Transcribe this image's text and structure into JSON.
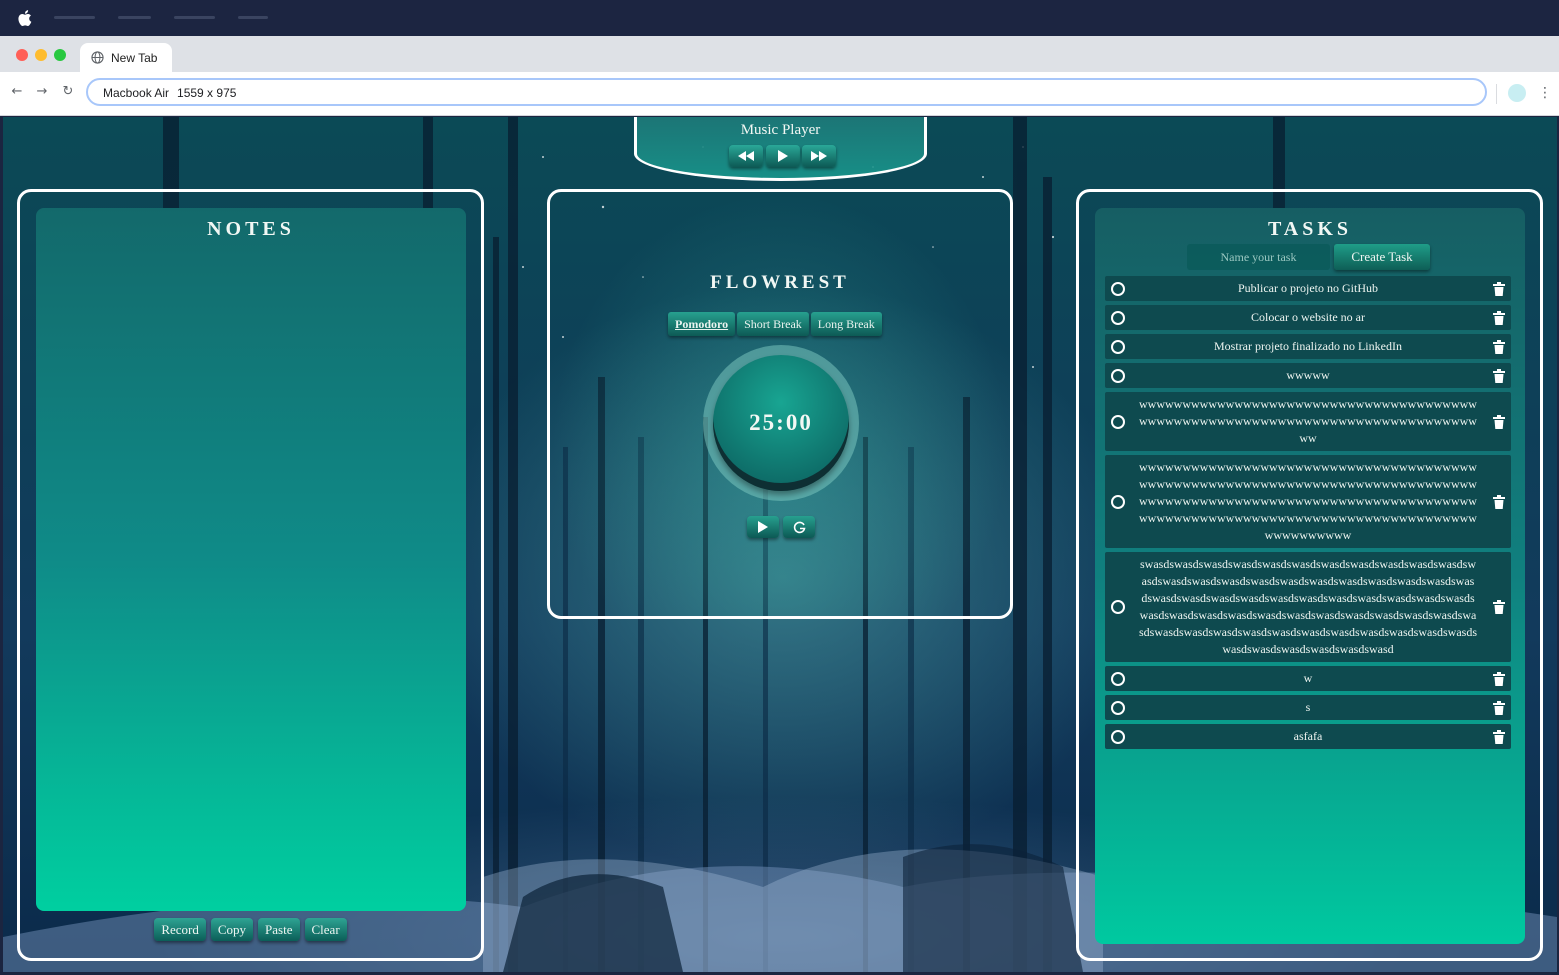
{
  "browser": {
    "tab_title": "New Tab",
    "address": "Macbook Air",
    "address_dims": "1559 x 975"
  },
  "music_player": {
    "title": "Music Player",
    "controls": [
      "rewind-icon",
      "play-icon",
      "fast-forward-icon"
    ]
  },
  "notes": {
    "title": "NOTES",
    "buttons": [
      "Record",
      "Copy",
      "Paste",
      "Clear"
    ]
  },
  "timer": {
    "title": "FLOWREST",
    "modes": [
      "Pomodoro",
      "Short Break",
      "Long Break"
    ],
    "active_mode": "Pomodoro",
    "time": "25:00",
    "controls": [
      "play-icon",
      "reset-icon"
    ]
  },
  "tasks": {
    "title": "TASKS",
    "input_placeholder": "Name your task",
    "create_label": "Create Task",
    "items": [
      {
        "text": "Publicar o projeto no GitHub"
      },
      {
        "text": "Colocar o website no ar"
      },
      {
        "text": "Mostrar projeto finalizado no LinkedIn"
      },
      {
        "text": "wwwww"
      },
      {
        "text": "wwwwwwwwwwwwwwwwwwwwwwwwwwwwwwwwwwwwwwwwwwwwwwwwwwwwwwwwwwwwwwwwwwwwwwwwwwwwwwww"
      },
      {
        "text": "wwwwwwwwwwwwwwwwwwwwwwwwwwwwwwwwwwwwwwwwwwwwwwwwwwwwwwwwwwwwwwwwwwwwwwwwwwwwwwwwwwwwwwwwwwwwwwwwwwwwwwwwwwwwwwwwwwwwwwwwwwwwwwwwwwwwwwwwwwwwwwwwwwwwwwwwwwwwwwwwwwwwww"
      },
      {
        "text": "swasdswasdswasdswasdswasdswasdswasdswasdswasdswasdswasdswasdswasdswasdswasdswasdswasdswasdswasdswasdswasdswasdswasdswasdswasdswasdswasdswasdswasdswasdswasdswasdswasdswasdswasdswasdswasdswasdswasdswasdswasdswasdswasdswasdswasdswasdswasdswasdswasdswasdswasdswasdswasdswasdswasdswasdswasdswasdswasdswasdswasdswasdswasd"
      },
      {
        "text": "w"
      },
      {
        "text": "s"
      },
      {
        "text": "asfafa"
      }
    ]
  },
  "colors": {
    "panel_border": "#ffffff",
    "glass_top": "#13696b",
    "glass_bottom": "#00cfa0",
    "task_row": "#0e4a4f"
  }
}
